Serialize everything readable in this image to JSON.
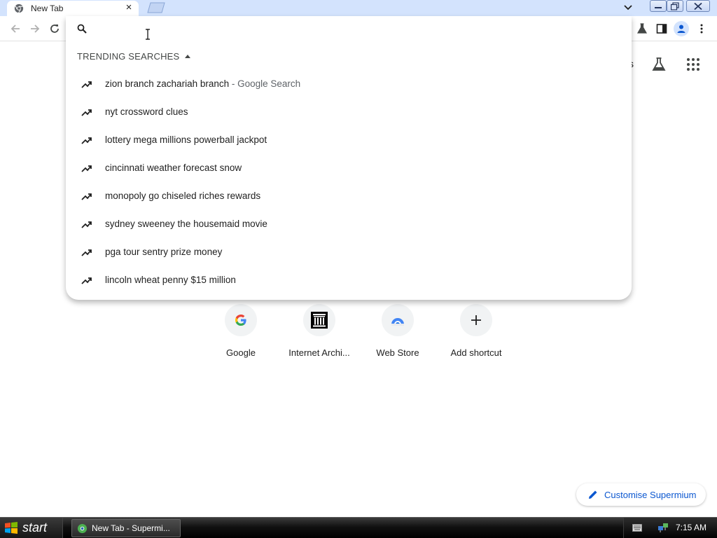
{
  "tab": {
    "title": "New Tab",
    "close_glyph": "×"
  },
  "icons": {
    "favicon": "chrome-icon",
    "back": "back-arrow-icon",
    "forward": "forward-arrow-icon",
    "reload": "reload-icon",
    "labs": "flask-icon",
    "side_panel": "side-panel-icon",
    "profile": "profile-icon",
    "menu": "kebab-menu-icon",
    "apps": "apps-grid-icon",
    "search": "search-icon",
    "trending": "trending-up-icon",
    "pencil": "pencil-icon"
  },
  "colors": {
    "tabstrip": "#d3e3fd",
    "accent": "#0b57d0",
    "text": "#1f1f1f",
    "muted": "#5f6368"
  },
  "omnibox": {
    "value": "",
    "placeholder": ""
  },
  "trending": {
    "header": "TRENDING SEARCHES",
    "items": [
      {
        "text": "zion branch zachariah branch",
        "suffix": " - Google Search"
      },
      {
        "text": "nyt crossword clues",
        "suffix": ""
      },
      {
        "text": "lottery mega millions powerball jackpot",
        "suffix": ""
      },
      {
        "text": "cincinnati weather forecast snow",
        "suffix": ""
      },
      {
        "text": "monopoly go chiseled riches rewards",
        "suffix": ""
      },
      {
        "text": "sydney sweeney the housemaid movie",
        "suffix": ""
      },
      {
        "text": "pga tour sentry prize money",
        "suffix": ""
      },
      {
        "text": "lincoln wheat penny $15 million",
        "suffix": ""
      }
    ]
  },
  "page": {
    "partial_text": "s",
    "shortcuts": [
      {
        "label": "Google",
        "icon": "google-icon"
      },
      {
        "label": "Internet Archi...",
        "icon": "internet-archive-icon"
      },
      {
        "label": "Web Store",
        "icon": "web-store-icon"
      },
      {
        "label": "Add shortcut",
        "icon": "plus-icon"
      }
    ],
    "customise_label": "Customise Supermium"
  },
  "taskbar": {
    "start_label": "start",
    "task_label": "New Tab - Supermi...",
    "clock": "7:15 AM"
  }
}
